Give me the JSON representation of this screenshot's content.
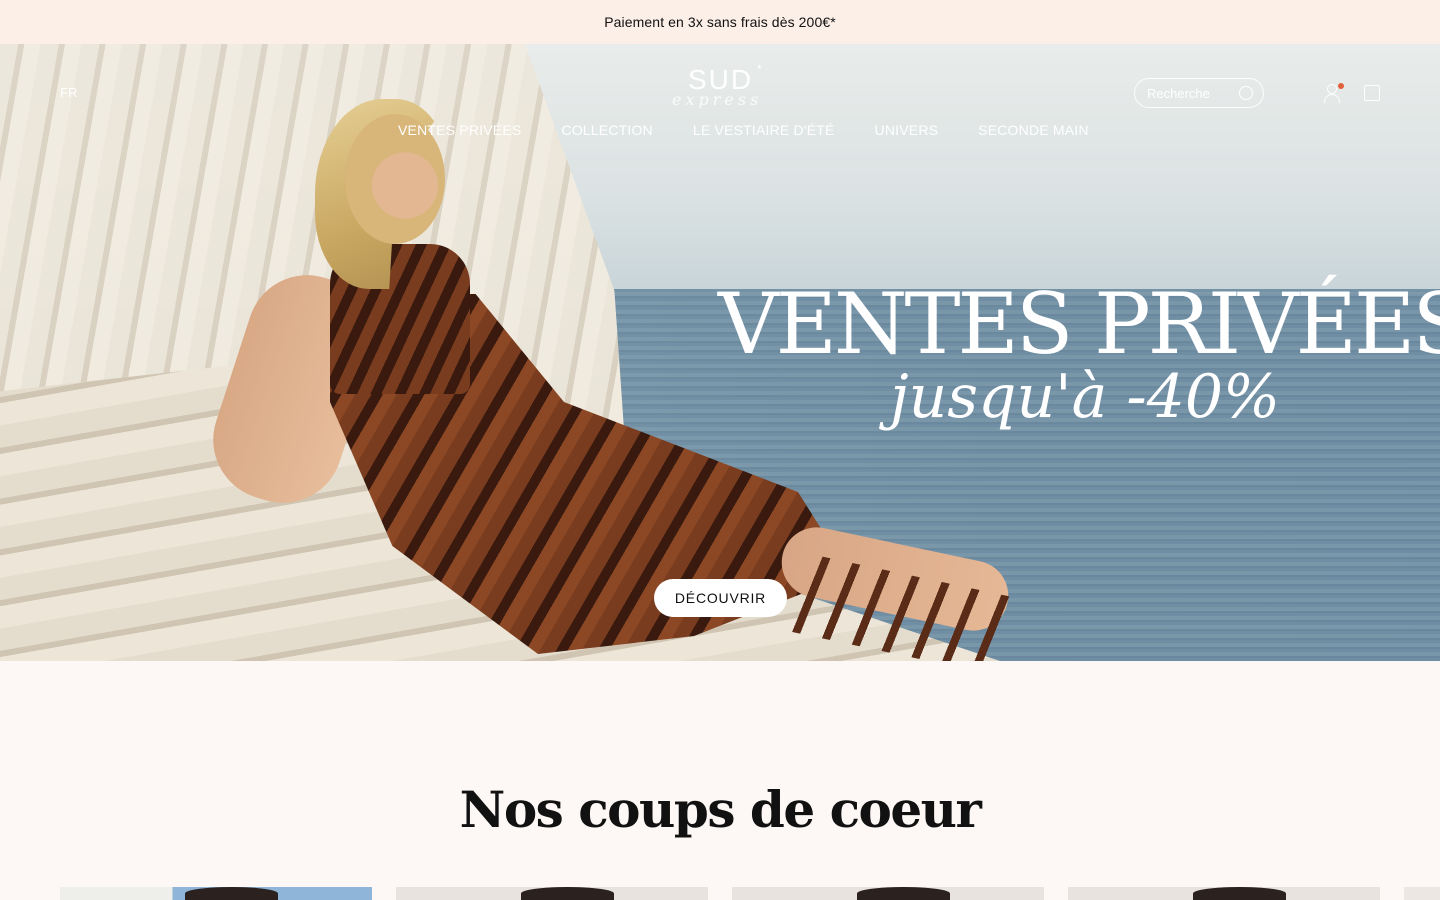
{
  "announcement": {
    "text": "Paiement en 3x sans frais dès 200€*"
  },
  "header": {
    "lang": "FR",
    "logo_main": "SUD",
    "logo_star": "*",
    "logo_sub": "express",
    "nav": [
      {
        "label": "VENTES PRIVÉES"
      },
      {
        "label": "COLLECTION"
      },
      {
        "label": "LE VESTIAIRE D'ÉTÉ"
      },
      {
        "label": "UNIVERS"
      },
      {
        "label": "SECONDE MAIN"
      }
    ],
    "search_placeholder": "Recherche"
  },
  "hero": {
    "title": "VENTES PRIVÉES",
    "subtitle": "jusqu'à -40%",
    "cta": "DÉCOUVRIR"
  },
  "featured": {
    "title": "Nos coups de coeur"
  },
  "colors": {
    "announcement_bg": "#fcefe8",
    "page_bg": "#fdf7f5",
    "accent_dot": "#e0603a"
  }
}
